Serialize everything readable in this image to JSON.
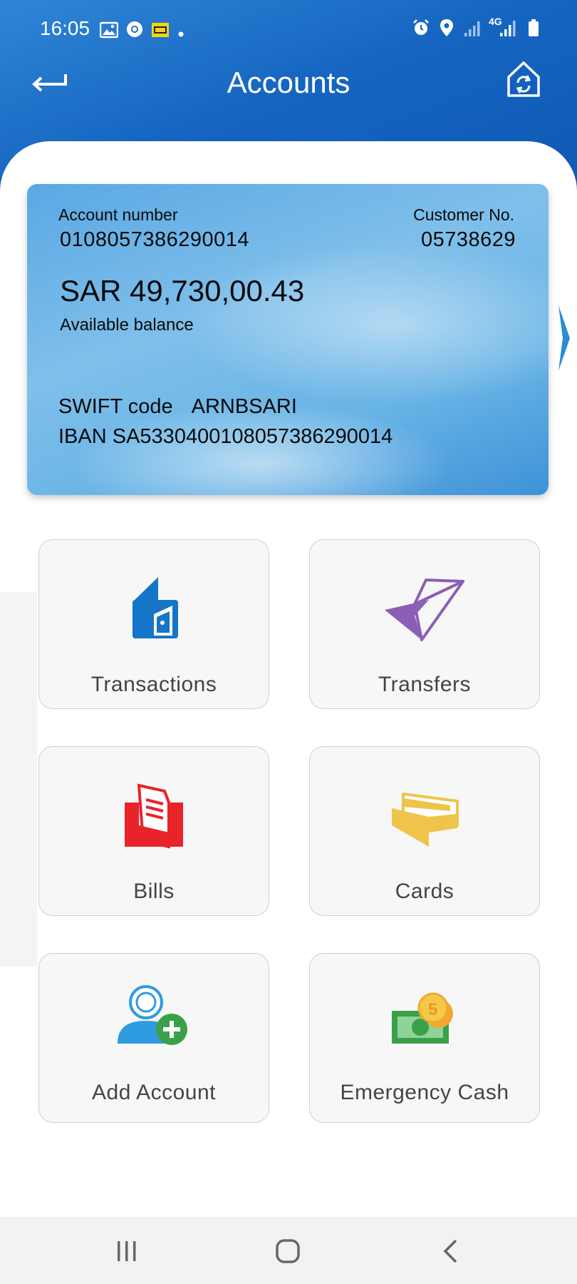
{
  "status_bar": {
    "time": "16:05",
    "left_icons": [
      "image-icon",
      "chrome-icon",
      "sim-card-icon",
      "dot-icon"
    ],
    "right_icons": [
      "alarm-icon",
      "location-icon",
      "signal-icon",
      "4g-signal-icon",
      "battery-icon"
    ],
    "network_label": "4G"
  },
  "header": {
    "title": "Accounts",
    "back_icon": "back-arrow-icon",
    "home_icon": "home-refresh-icon"
  },
  "account": {
    "account_number_label": "Account number",
    "account_number": "0108057386290014",
    "customer_label": "Customer No.",
    "customer_number": "05738629",
    "balance": "SAR 49,730,00.43",
    "balance_label": "Available balance",
    "swift_label": "SWIFT code",
    "swift_code": "ARNBSARI",
    "iban": "IBAN SA5330400108057386290014"
  },
  "tiles": [
    {
      "label": "Transactions",
      "icon": "wallet-icon",
      "color": "#1576c9"
    },
    {
      "label": "Transfers",
      "icon": "paper-plane-icon",
      "color": "#8b5fb5"
    },
    {
      "label": "Bills",
      "icon": "bills-icon",
      "color": "#e8242a"
    },
    {
      "label": "Cards",
      "icon": "cards-folder-icon",
      "color": "#eec54a"
    },
    {
      "label": "Add Account",
      "icon": "add-user-icon",
      "color": "#2f9be0"
    },
    {
      "label": "Emergency Cash",
      "icon": "cash-coins-icon",
      "color": "#3aa04a"
    }
  ],
  "nav": {
    "recents_icon": "recents-icon",
    "home_icon": "home-circle-icon",
    "back_icon": "back-chevron-icon"
  }
}
